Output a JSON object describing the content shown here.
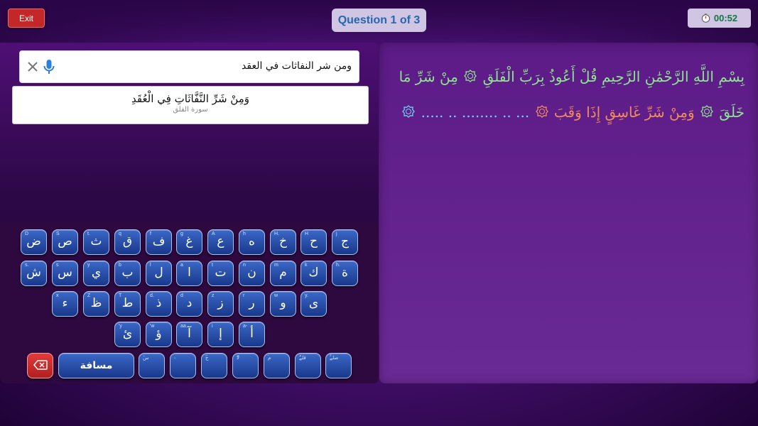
{
  "header": {
    "exit_label": "Exit",
    "question_label": "Question 1 of 3",
    "timer_value": "00:52",
    "timer_icon": "stopwatch-icon"
  },
  "search": {
    "value": "ومن شر النفاثات في العقد",
    "clear_icon": "close-icon",
    "mic_icon": "microphone-icon"
  },
  "suggestion": {
    "verse": "وَمِنْ شَرِّ النَّفَّاثَاتِ فِي الْعُقَدِ",
    "surah": "سورة الفلق"
  },
  "keyboard": {
    "keys": [
      {
        "label": "ض",
        "hint": "D"
      },
      {
        "label": "ص",
        "hint": "S"
      },
      {
        "label": "ث",
        "hint": "t."
      },
      {
        "label": "ق",
        "hint": "q"
      },
      {
        "label": "ف",
        "hint": "f"
      },
      {
        "label": "غ",
        "hint": "g"
      },
      {
        "label": "ع",
        "hint": "A"
      },
      {
        "label": "ه",
        "hint": "h"
      },
      {
        "label": "خ",
        "hint": "H."
      },
      {
        "label": "ح",
        "hint": "H"
      },
      {
        "label": "ج",
        "hint": "j"
      },
      {
        "label": "ش",
        "hint": "s."
      },
      {
        "label": "س",
        "hint": "s"
      },
      {
        "label": "ي",
        "hint": "y"
      },
      {
        "label": "ب",
        "hint": "b"
      },
      {
        "label": "ل",
        "hint": "l"
      },
      {
        "label": "ا",
        "hint": "a"
      },
      {
        "label": "ت",
        "hint": "t"
      },
      {
        "label": "ن",
        "hint": "n"
      },
      {
        "label": "م",
        "hint": "m"
      },
      {
        "label": "ك",
        "hint": "k"
      },
      {
        "label": "ة",
        "hint": "h."
      },
      {
        "label": "ء",
        "hint": "x"
      },
      {
        "label": "ظ",
        "hint": "Z"
      },
      {
        "label": "ط",
        "hint": "T"
      },
      {
        "label": "ذ",
        "hint": "d."
      },
      {
        "label": "د",
        "hint": "d"
      },
      {
        "label": "ز",
        "hint": "z"
      },
      {
        "label": "ر",
        "hint": "r"
      },
      {
        "label": "و",
        "hint": "w"
      },
      {
        "label": "ى",
        "hint": "y."
      },
      {
        "label": "ئ",
        "hint": "'y"
      },
      {
        "label": "ؤ",
        "hint": "'w"
      },
      {
        "label": "آ",
        "hint": "aa"
      },
      {
        "label": "إ",
        "hint": "i"
      },
      {
        "label": "أ",
        "hint": "a-"
      },
      {
        "label": "",
        "hint": "ٓس"
      },
      {
        "label": "",
        "hint": "ۦ"
      },
      {
        "label": "",
        "hint": "ۜج"
      },
      {
        "label": "",
        "hint": "ۖلا"
      },
      {
        "label": "",
        "hint": "ۘم"
      },
      {
        "label": "",
        "hint": "ۗقلے"
      },
      {
        "label": "",
        "hint": "ۚصلے"
      }
    ],
    "space_label": "مسافة",
    "backspace_icon": "backspace-icon"
  },
  "verse": {
    "line": [
      {
        "text": "بِسْمِ اللَّهِ الرَّحْمَٰنِ الرَّحِيمِ قُلْ أَعُوذُ بِرَبِّ الْفَلَقِ",
        "color": "green"
      },
      {
        "text": "مِنْ شَرِّ مَا خَلَقَ",
        "color": "green"
      },
      {
        "text": "وَمِنْ شَرِّ غَاسِقٍ إِذَا وَقَبَ",
        "color": "orange"
      },
      {
        "text": "... .. ........ .. .....",
        "color": "cyan"
      }
    ],
    "colors": {
      "green": "#8ee58f",
      "orange": "#f08c5a",
      "cyan": "#6fd0f2"
    }
  }
}
